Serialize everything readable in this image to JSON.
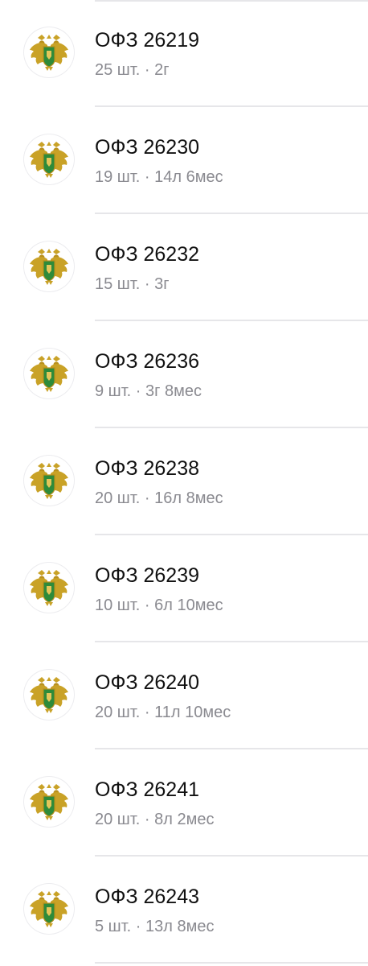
{
  "bonds": [
    {
      "name": "ОФЗ 26219",
      "meta": "25 шт. · 2г"
    },
    {
      "name": "ОФЗ 26230",
      "meta": "19 шт. · 14л 6мес"
    },
    {
      "name": "ОФЗ 26232",
      "meta": "15 шт. · 3г"
    },
    {
      "name": "ОФЗ 26236",
      "meta": "9 шт. · 3г 8мес"
    },
    {
      "name": "ОФЗ 26238",
      "meta": "20 шт. · 16л 8мес"
    },
    {
      "name": "ОФЗ 26239",
      "meta": "10 шт. · 6л 10мес"
    },
    {
      "name": "ОФЗ 26240",
      "meta": "20 шт. · 11л 10мес"
    },
    {
      "name": "ОФЗ 26241",
      "meta": "20 шт. · 8л 2мес"
    },
    {
      "name": "ОФЗ 26243",
      "meta": "5 шт. · 13л 8мес"
    }
  ],
  "logo_icon": "russian-coat-of-arms-icon",
  "colors": {
    "title": "#111111",
    "subtitle": "#8a8a90",
    "divider": "#e6e6e9",
    "emblem_gold": "#c9a227",
    "emblem_green": "#2e8b3a"
  }
}
